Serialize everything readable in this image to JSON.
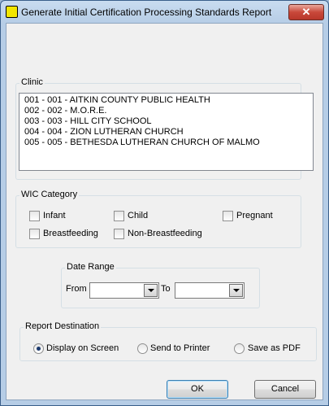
{
  "window": {
    "title": "Generate Initial Certification Processing Standards Report",
    "close_glyph": "✕"
  },
  "clinic": {
    "label": "Clinic",
    "items": [
      "001 - 001 - AITKIN COUNTY PUBLIC HEALTH",
      "002 - 002 - M.O.R.E.",
      "003 - 003 - HILL CITY SCHOOL",
      "004 - 004 - ZION LUTHERAN CHURCH",
      "005 - 005 - BETHESDA LUTHERAN CHURCH OF MALMO"
    ]
  },
  "wic": {
    "label": "WIC Category",
    "options": [
      {
        "label": "Infant",
        "checked": false
      },
      {
        "label": "Child",
        "checked": false
      },
      {
        "label": "Pregnant",
        "checked": false
      },
      {
        "label": "Breastfeeding",
        "checked": false
      },
      {
        "label": "Non-Breastfeeding",
        "checked": false
      }
    ]
  },
  "date_range": {
    "label": "Date Range",
    "from_label": "From",
    "to_label": "To",
    "from_value": "",
    "to_value": ""
  },
  "destination": {
    "label": "Report Destination",
    "options": [
      {
        "label": "Display on Screen",
        "selected": true
      },
      {
        "label": "Send to Printer",
        "selected": false
      },
      {
        "label": "Save as PDF",
        "selected": false
      }
    ]
  },
  "buttons": {
    "ok": "OK",
    "cancel": "Cancel"
  }
}
